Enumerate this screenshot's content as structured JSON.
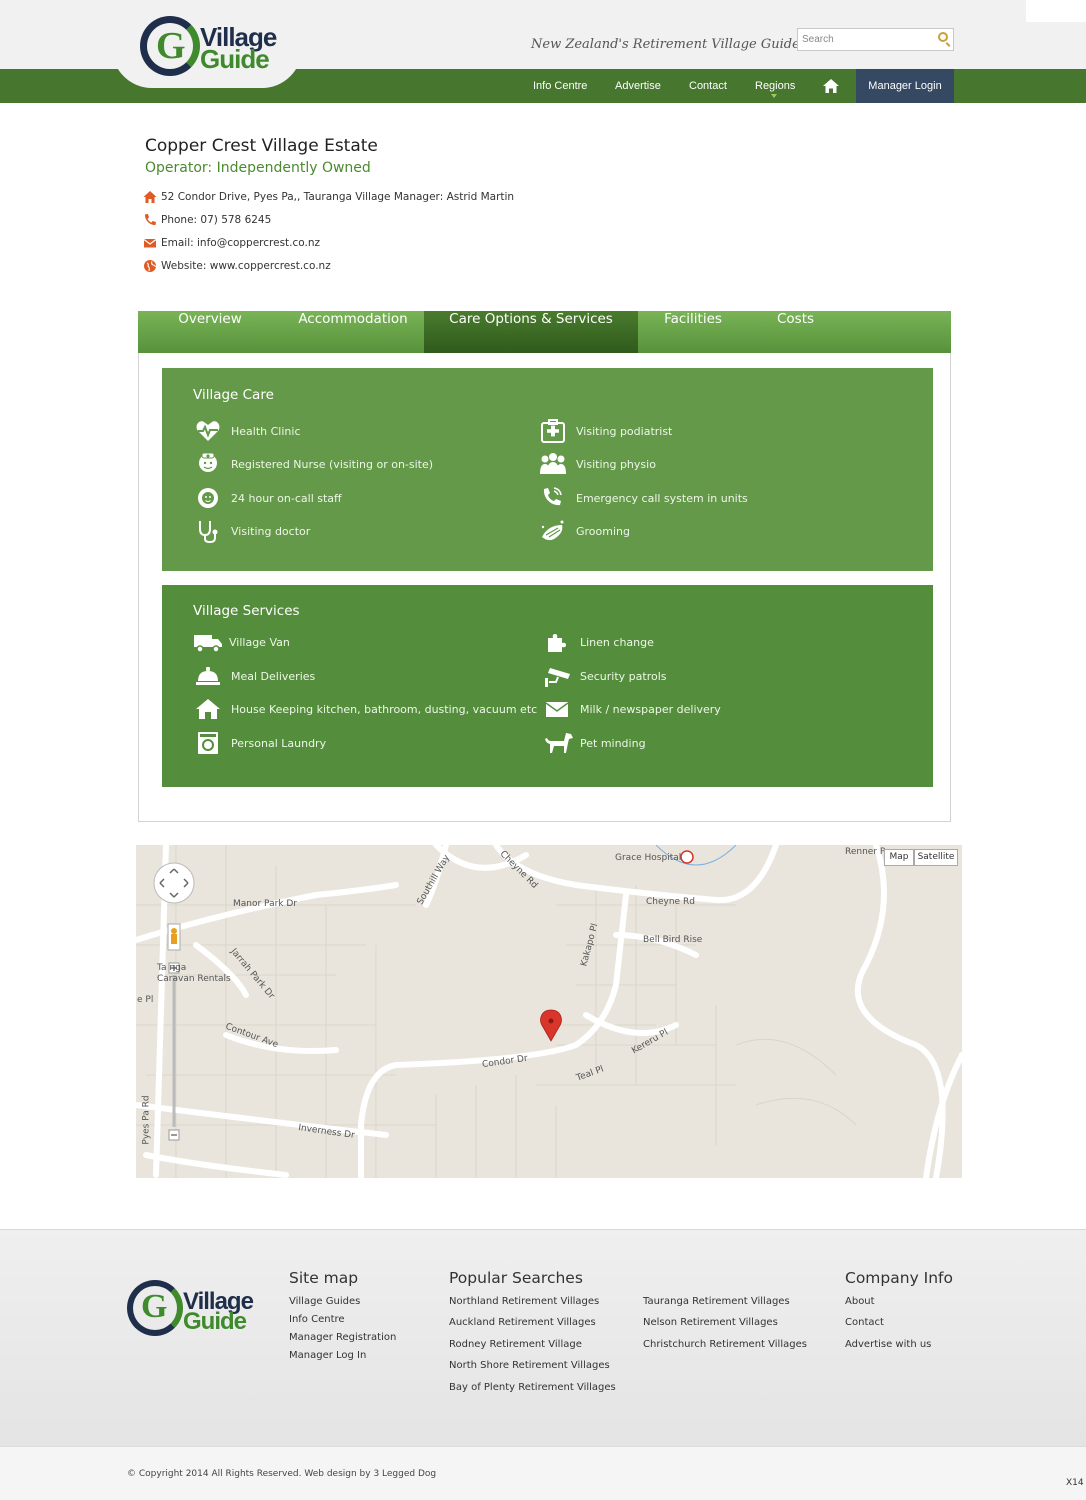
{
  "header": {
    "logo_text_1": "Village",
    "logo_text_2": "Guide",
    "tagline": "New Zealand's Retirement Village Guide",
    "search_placeholder": "Search",
    "nav": [
      "Info Centre",
      "Advertise",
      "Contact",
      "Regions"
    ],
    "manager_login": "Manager Login"
  },
  "village": {
    "name": "Copper Crest Village Estate",
    "operator": "Operator: Independently Owned",
    "address": "52 Condor Drive, Pyes Pa,, Tauranga  Village Manager: Astrid Martin",
    "phone": "Phone: 07) 578 6245",
    "email": "Email: info@coppercrest.co.nz",
    "website": "Website: www.coppercrest.co.nz"
  },
  "tabs": [
    "Overview",
    "Accommodation",
    "Care Options & Services",
    "Facilities",
    "Costs"
  ],
  "active_tab": "Care Options & Services",
  "care": {
    "title": "Village Care",
    "left": [
      "Health Clinic",
      "Registered Nurse (visiting or on-site)",
      "24 hour on-call staff",
      "Visiting doctor"
    ],
    "right": [
      "Visiting podiatrist",
      "Visiting physio",
      "Emergency call system in units",
      "Grooming"
    ]
  },
  "services": {
    "title": "Village Services",
    "left": [
      "Village Van",
      "Meal Deliveries",
      "House Keeping kitchen, bathroom, dusting, vacuum etc",
      "Personal Laundry"
    ],
    "right": [
      "Linen change",
      "Security patrols",
      "Milk / newspaper delivery",
      "Pet minding"
    ]
  },
  "map": {
    "type_map": "Map",
    "type_satellite": "Satellite",
    "labels": {
      "grace": "Grace Hospital",
      "renner": "Renner P",
      "manor": "Manor Park Dr",
      "southill": "Southill Way",
      "cheyne1": "Cheyne Rd",
      "cheyne2": "Cheyne Rd",
      "bellbird": "Bell Bird Rise",
      "kakapo": "Kakapo Pl",
      "tauranga1": "Ta   nga",
      "tauranga2": "Caravan Rentals",
      "jarrah": "Jarrah Park Dr",
      "contour": "Contour Ave",
      "condor": "Condor Dr",
      "teal": "Teal Pl",
      "kereru": "Kereru Pl",
      "inverness": "Inverness Dr",
      "pyes": "Pyes Pa Rd",
      "epl": "e Pl"
    }
  },
  "footer": {
    "sitemap_title": "Site map",
    "sitemap": [
      "Village Guides",
      "Info Centre",
      "Manager Registration",
      "Manager Log In"
    ],
    "popular_title": "Popular Searches",
    "popular_left": [
      "Northland Retirement Villages",
      "Auckland Retirement Villages",
      "Rodney Retirement Village",
      "North Shore Retirement Villages",
      "Bay of Plenty Retirement Villages"
    ],
    "popular_right": [
      "Tauranga Retirement Villages",
      "Nelson Retirement Villages",
      "Christchurch Retirement Villages"
    ],
    "company_title": "Company Info",
    "company": [
      "About",
      "Contact",
      "Advertise with us"
    ],
    "copyright": "© Copyright 2014 All Rights Reserved. Web design by 3 Legged Dog",
    "corner": "X14"
  },
  "colors": {
    "brand_green": "#47772f",
    "care_green": "#64994a",
    "services_green": "#548e3c",
    "navy": "#364962",
    "accent_orange": "#e05a24"
  }
}
